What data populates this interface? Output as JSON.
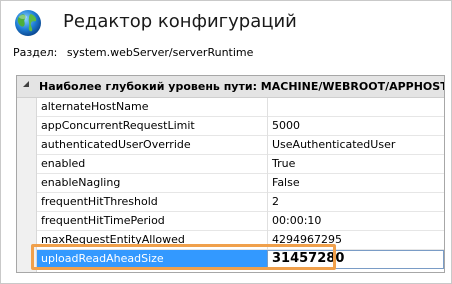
{
  "window": {
    "title": "Редактор конфигураций",
    "icon": "globe-icon"
  },
  "section": {
    "label": "Раздел:",
    "value": "system.webServer/serverRuntime"
  },
  "grid": {
    "header": "Наиболее глубокий уровень пути: MACHINE/WEBROOT/APPHOST",
    "rows": [
      {
        "name": "alternateHostName",
        "value": ""
      },
      {
        "name": "appConcurrentRequestLimit",
        "value": "5000"
      },
      {
        "name": "authenticatedUserOverride",
        "value": "UseAuthenticatedUser"
      },
      {
        "name": "enabled",
        "value": "True"
      },
      {
        "name": "enableNagling",
        "value": "False"
      },
      {
        "name": "frequentHitThreshold",
        "value": "2"
      },
      {
        "name": "frequentHitTimePeriod",
        "value": "00:00:10"
      },
      {
        "name": "maxRequestEntityAllowed",
        "value": "4294967295"
      },
      {
        "name": "uploadReadAheadSize",
        "value": "31457280",
        "selected": true
      }
    ]
  },
  "colors": {
    "selection": "#3399ff",
    "highlight_border": "#f0a04b"
  }
}
